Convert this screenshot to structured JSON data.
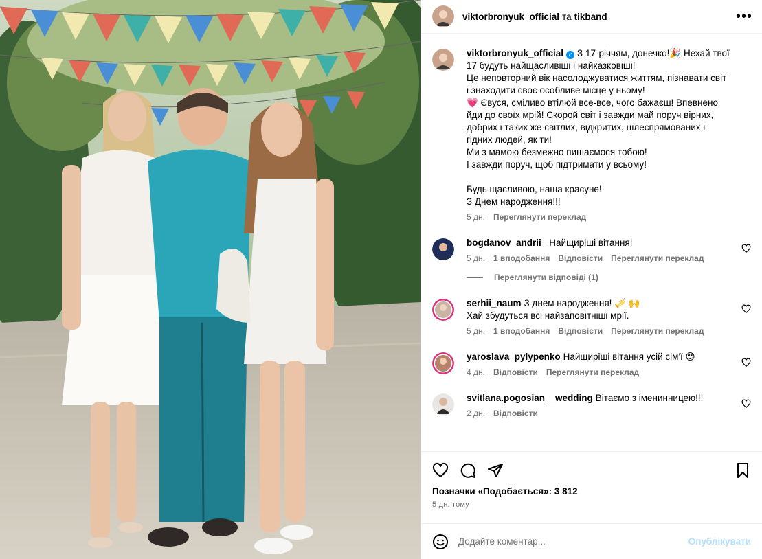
{
  "header": {
    "author": "viktorbronyuk_official",
    "conjunction": "та",
    "coauthor": "tikband"
  },
  "caption": {
    "username": "viktorbronyuk_official",
    "lines": [
      "З 17-річчям, донечко!🎉 Нехай твої 17 будуть найщасливіші і найказковіші!",
      "Це неповторний вік насолоджуватися життям, пізнавати світ і знаходити своє особливе місце у ньому!",
      "💗 Євуся, сміливо втілюй все-все, чого бажаєш! Впевнено йди до своїх мрій! Скорой світ і завжди май поруч вірних, добрих і таких же світлих, відкритих, цілеспрямованих і гідних людей, як ти!",
      "Ми з мамою безмежно пишаємося тобою!",
      "І завжди поруч, щоб підтримати у всьому!",
      "",
      "Будь щасливою, наша красуне!",
      "З Днем народження!!!"
    ],
    "time": "5 дн.",
    "translate": "Переглянути переклад"
  },
  "comments": [
    {
      "username": "bogdanov_andrii_",
      "text": "Найщиріші вітання!",
      "time": "5 дн.",
      "likes": "1 вподобання",
      "reply": "Відповісти",
      "translate": "Переглянути переклад",
      "view_replies": "Переглянути відповіді (1)"
    },
    {
      "username": "serhii_naum",
      "text": "З днем народження! 🎺 🙌",
      "text2": "Хай збудуться всі найзаповітніші мрії.",
      "time": "5 дн.",
      "likes": "1 вподобання",
      "reply": "Відповісти",
      "translate": "Переглянути переклад"
    },
    {
      "username": "yaroslava_pylypenko",
      "text": "Найщиріші вітання усій сім'ї 😍",
      "time": "4 дн.",
      "reply": "Відповісти",
      "translate": "Переглянути переклад"
    },
    {
      "username": "svitlana.pogosian__wedding",
      "text": "Вітаємо з іменинницею!!!",
      "time": "2 дн.",
      "reply": "Відповісти"
    }
  ],
  "footer": {
    "likes_label": "Позначки «Подобається»: 3 812",
    "posted_ago": "5 дн. тому"
  },
  "add_comment": {
    "placeholder": "Додайте коментар...",
    "publish": "Опублікувати"
  },
  "icons": {
    "more": "more-options-icon",
    "like": "heart-icon",
    "comment": "comment-icon",
    "share": "share-icon",
    "save": "bookmark-icon",
    "emoji": "emoji-icon"
  },
  "colors": {
    "link_disabled": "#b2dffc",
    "secondary_text": "#737373",
    "verified": "#0095f6"
  }
}
